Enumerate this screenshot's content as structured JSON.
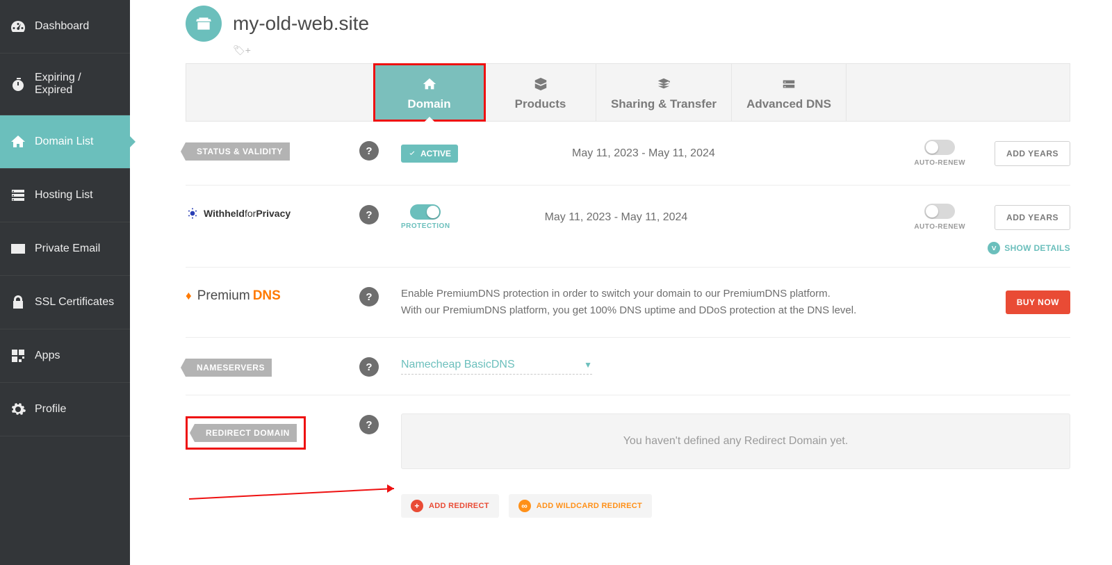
{
  "sidebar": {
    "items": [
      {
        "label": "Dashboard"
      },
      {
        "label": "Expiring / Expired"
      },
      {
        "label": "Domain List"
      },
      {
        "label": "Hosting List"
      },
      {
        "label": "Private Email"
      },
      {
        "label": "SSL Certificates"
      },
      {
        "label": "Apps"
      },
      {
        "label": "Profile"
      }
    ]
  },
  "header": {
    "site_title": "my-old-web.site"
  },
  "tabs": {
    "domain": "Domain",
    "products": "Products",
    "sharing": "Sharing & Transfer",
    "advdns": "Advanced DNS"
  },
  "status": {
    "ribbon": "STATUS & VALIDITY",
    "active": "ACTIVE",
    "dates": "May 11, 2023 - May 11, 2024",
    "autorenew": "AUTO-RENEW",
    "addyears": "ADD YEARS"
  },
  "privacy": {
    "brand_withheld": "Withheld",
    "brand_for": "for",
    "brand_privacy": "Privacy",
    "protection": "PROTECTION",
    "dates": "May 11, 2023 - May 11, 2024",
    "autorenew": "AUTO-RENEW",
    "addyears": "ADD YEARS",
    "show_details": "SHOW DETAILS"
  },
  "premium": {
    "brand_premium": "Premium",
    "brand_dns": "DNS",
    "desc1": "Enable PremiumDNS protection in order to switch your domain to our PremiumDNS platform.",
    "desc2": "With our PremiumDNS platform, you get 100% DNS uptime and DDoS protection at the DNS level.",
    "buy": "BUY NOW"
  },
  "nameservers": {
    "ribbon": "NAMESERVERS",
    "value": "Namecheap BasicDNS"
  },
  "redirect": {
    "ribbon": "REDIRECT DOMAIN",
    "empty": "You haven't defined any Redirect Domain yet.",
    "add": "ADD REDIRECT",
    "add_wildcard": "ADD WILDCARD REDIRECT"
  }
}
